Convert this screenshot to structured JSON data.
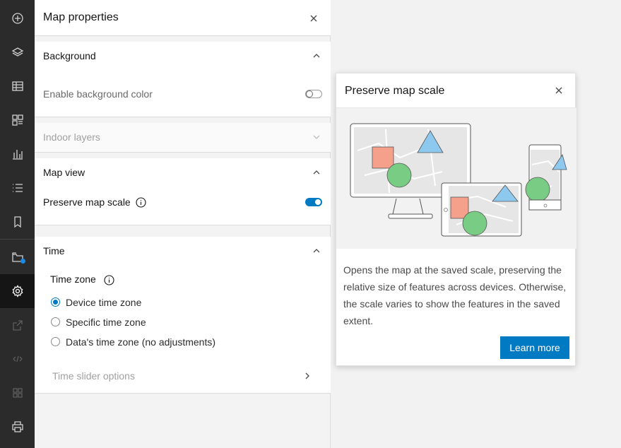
{
  "rail": {
    "items": [
      {
        "name": "add-icon",
        "label": "Add"
      },
      {
        "name": "layers-icon",
        "label": "Layers"
      },
      {
        "name": "table-icon",
        "label": "Tables"
      },
      {
        "name": "legend-icon",
        "label": "Legend"
      },
      {
        "name": "charts-icon",
        "label": "Charts"
      },
      {
        "name": "list-icon",
        "label": "Properties list"
      },
      {
        "name": "bookmark-icon",
        "label": "Bookmarks"
      },
      {
        "name": "save-icon",
        "label": "Save"
      },
      {
        "name": "settings-icon",
        "label": "Map properties"
      },
      {
        "name": "share-icon",
        "label": "Share"
      },
      {
        "name": "embed-icon",
        "label": "Embed"
      },
      {
        "name": "apps-icon",
        "label": "Create app"
      },
      {
        "name": "print-icon",
        "label": "Print"
      }
    ],
    "badge_color": "#1a8ae5"
  },
  "panel": {
    "title": "Map properties",
    "background": {
      "title": "Background",
      "enable_color_label": "Enable background color",
      "enable_color_on": false
    },
    "indoor": {
      "title": "Indoor layers"
    },
    "map_view": {
      "title": "Map view",
      "preserve_label": "Preserve map scale",
      "preserve_on": true
    },
    "time": {
      "title": "Time",
      "zone_label": "Time zone",
      "options": [
        "Device time zone",
        "Specific time zone",
        "Data's time zone (no adjustments)"
      ],
      "selected_index": 0,
      "slider_options_label": "Time slider options"
    }
  },
  "popover": {
    "title": "Preserve map scale",
    "description": "Opens the map at the saved scale, preserving the relative size of features across devices. Otherwise, the scale varies to show the features in the saved extent.",
    "learn_more": "Learn more"
  },
  "colors": {
    "accent": "#007ac2",
    "rail_bg": "#2b2b2b",
    "square": "#f4a08a",
    "circle": "#79cc84",
    "triangle": "#8dc8ee"
  }
}
